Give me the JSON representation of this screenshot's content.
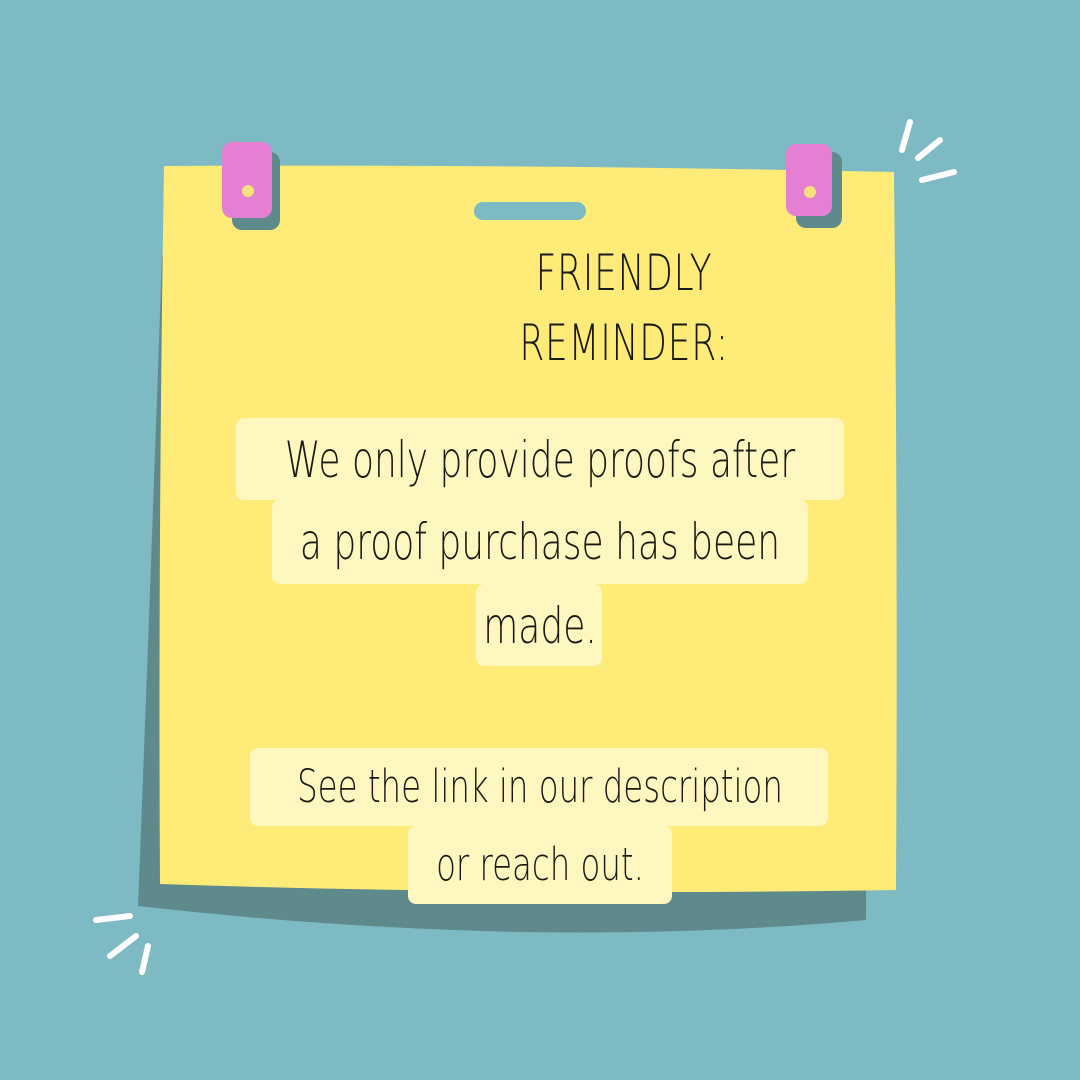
{
  "colors": {
    "background": "#7dbac3",
    "note": "#ffeb78",
    "note_shadow": "#5e8a8c",
    "highlight": "#fff6c0",
    "clip": "#e47fd4",
    "clip_dot": "#f6e27a",
    "text": "#1a1a14"
  },
  "note": {
    "title_lines": [
      "FRIENDLY",
      "REMINDER:"
    ],
    "body_lines": [
      "We only provide proofs after",
      "a proof purchase has been",
      "made."
    ],
    "footer_lines": [
      "See the link in our description",
      "or reach out."
    ]
  },
  "icons": [
    "binder-clip-icon",
    "binder-clip-icon",
    "hang-slot-icon",
    "sparkle-lines-icon",
    "sparkle-lines-icon"
  ]
}
